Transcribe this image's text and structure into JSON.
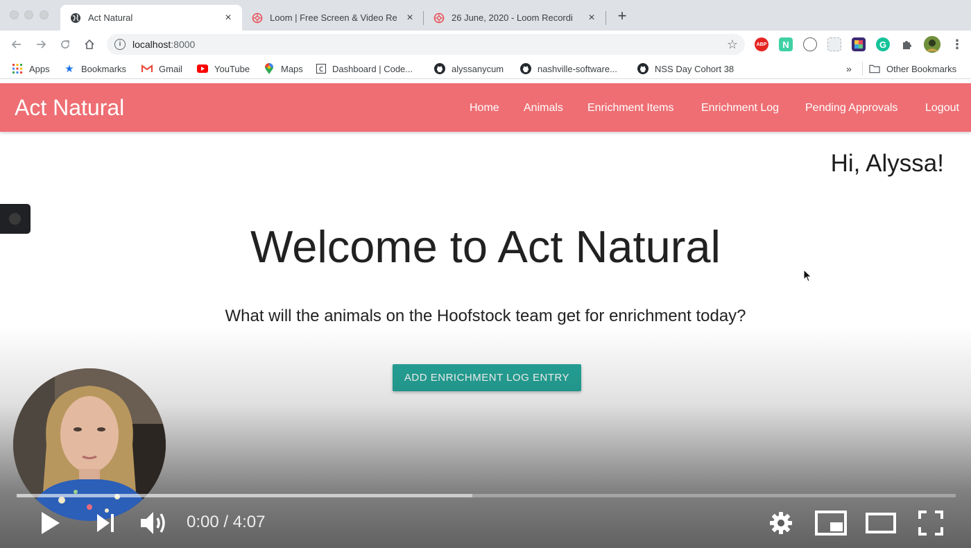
{
  "browser": {
    "tabs": [
      {
        "title": "Act Natural",
        "active": true,
        "favicon": "globe-icon"
      },
      {
        "title": "Loom | Free Screen & Video Re",
        "active": false,
        "favicon": "loom-icon"
      },
      {
        "title": "26 June, 2020 - Loom Recordi",
        "active": false,
        "favicon": "loom-icon"
      }
    ],
    "address": {
      "host": "localhost",
      "port": ":8000"
    },
    "bookmarks": [
      {
        "label": "Apps",
        "icon": "apps-grid-icon"
      },
      {
        "label": "Bookmarks",
        "icon": "star-icon"
      },
      {
        "label": "Gmail",
        "icon": "gmail-icon"
      },
      {
        "label": "YouTube",
        "icon": "youtube-icon"
      },
      {
        "label": "Maps",
        "icon": "maps-pin-icon"
      },
      {
        "label": "Dashboard | Code...",
        "icon": "code-icon"
      },
      {
        "label": "alyssanycum",
        "icon": "github-icon"
      },
      {
        "label": "nashville-software...",
        "icon": "github-icon"
      },
      {
        "label": "NSS Day Cohort 38",
        "icon": "github-icon"
      }
    ],
    "overflow_label": "»",
    "other_bookmarks": "Other Bookmarks",
    "extensions": [
      "ABP",
      "N"
    ]
  },
  "app": {
    "brand": "Act Natural",
    "nav": [
      "Home",
      "Animals",
      "Enrichment Items",
      "Enrichment Log",
      "Pending Approvals",
      "Logout"
    ],
    "greeting": "Hi, Alyssa!",
    "heading": "Welcome to Act Natural",
    "subheading": "What will the animals on the Hoofstock team get for enrichment today?",
    "cta": "ADD ENRICHMENT LOG ENTRY",
    "colors": {
      "navbar": "#ee6e73",
      "button": "#26a69a"
    }
  },
  "player": {
    "current_time": "0:00",
    "separator": " / ",
    "duration": "4:07",
    "buffered_fraction": 0.485,
    "played_fraction": 0
  }
}
